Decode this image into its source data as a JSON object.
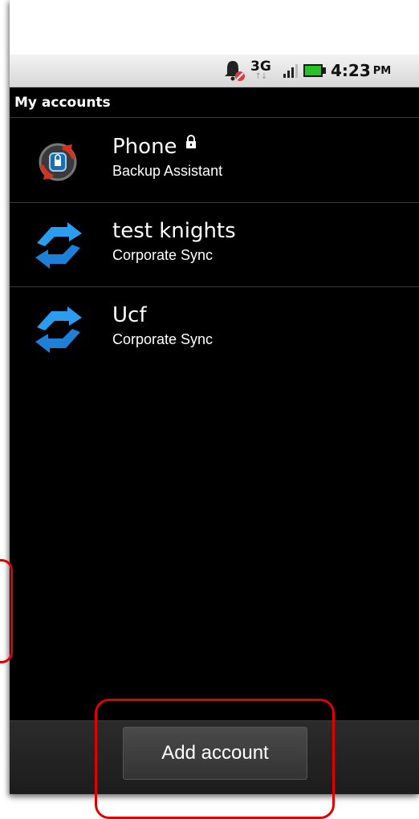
{
  "status_bar": {
    "network": "3G",
    "network_arrows": "↑↓",
    "time": "4:23",
    "time_suffix": "PM",
    "icons": [
      "bell-muted-icon",
      "signal-icon",
      "battery-icon"
    ]
  },
  "header": {
    "title": "My accounts"
  },
  "accounts": [
    {
      "name": "Phone",
      "type": "Backup Assistant",
      "icon": "backup-assistant-icon",
      "locked": true
    },
    {
      "name": "test knights",
      "type": "Corporate Sync",
      "icon": "sync-icon",
      "locked": false
    },
    {
      "name": "Ucf",
      "type": "Corporate Sync",
      "icon": "sync-icon",
      "locked": false
    }
  ],
  "footer": {
    "add_account_label": "Add account"
  },
  "colors": {
    "background": "#000000",
    "text": "#ffffff",
    "sync_blue": "#1e90e8",
    "annotation_red": "#e00000"
  }
}
